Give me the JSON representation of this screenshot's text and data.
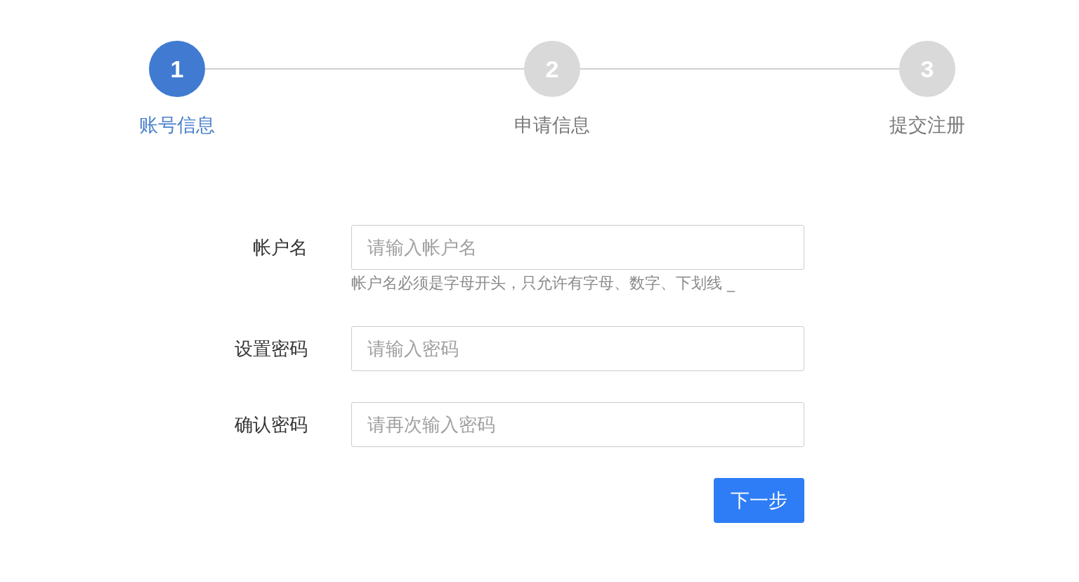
{
  "steps": [
    {
      "number": "1",
      "label": "账号信息",
      "active": true
    },
    {
      "number": "2",
      "label": "申请信息",
      "active": false
    },
    {
      "number": "3",
      "label": "提交注册",
      "active": false
    }
  ],
  "form": {
    "fields": [
      {
        "label": "帐户名",
        "placeholder": "请输入帐户名",
        "hint": "帐户名必须是字母开头，只允许有字母、数字、下划线 _"
      },
      {
        "label": "设置密码",
        "placeholder": "请输入密码"
      },
      {
        "label": "确认密码",
        "placeholder": "请再次输入密码"
      }
    ],
    "button": {
      "label": "下一步"
    }
  }
}
